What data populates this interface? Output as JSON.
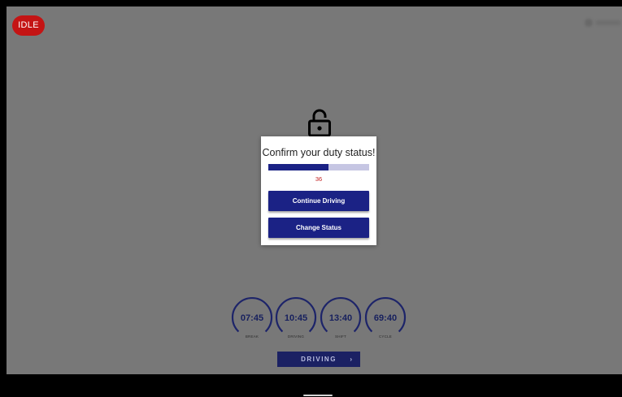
{
  "status_badge": {
    "label": "IDLE",
    "color": "#c41414"
  },
  "lock": {
    "icon": "lock-open-icon"
  },
  "dialog": {
    "title": "Confirm your duty status!",
    "progress_fraction": 0.6,
    "countdown": "36",
    "continue_label": "Continue Driving",
    "change_label": "Change Status"
  },
  "gauges": [
    {
      "time": "07:45",
      "label": "BREAK"
    },
    {
      "time": "10:45",
      "label": "DRIVING"
    },
    {
      "time": "13:40",
      "label": "SHIFT"
    },
    {
      "time": "69:40",
      "label": "CYCLE"
    }
  ],
  "status_pill": {
    "label": "DRIVING",
    "icon": "chevron-right-icon"
  },
  "colors": {
    "accent": "#1b2285",
    "alert": "#c21d1d",
    "overlay": "#787878"
  }
}
